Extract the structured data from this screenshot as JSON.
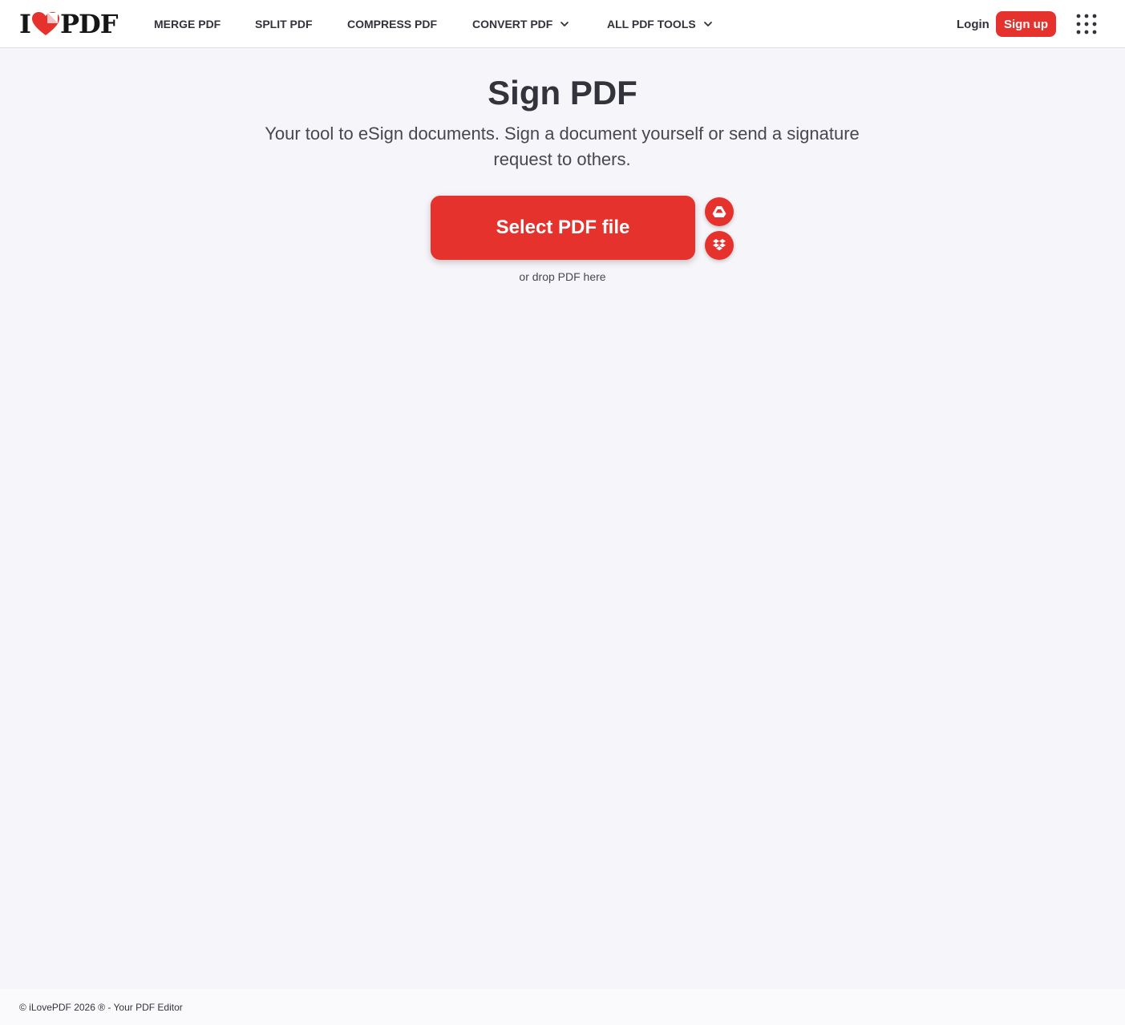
{
  "header": {
    "logo": {
      "prefix": "I",
      "suffix": "PDF"
    },
    "nav": [
      {
        "label": "MERGE PDF",
        "dropdown": false
      },
      {
        "label": "SPLIT PDF",
        "dropdown": false
      },
      {
        "label": "COMPRESS PDF",
        "dropdown": false
      },
      {
        "label": "CONVERT PDF",
        "dropdown": true
      },
      {
        "label": "ALL PDF TOOLS",
        "dropdown": true
      }
    ],
    "login_label": "Login",
    "signup_label": "Sign up",
    "apps_icon": "grid-icon"
  },
  "main": {
    "title": "Sign PDF",
    "subtitle": "Your tool to eSign documents. Sign a document yourself or send a signature request to others.",
    "select_button_label": "Select PDF file",
    "cloud_buttons": [
      {
        "icon": "google-drive-icon"
      },
      {
        "icon": "dropbox-icon"
      }
    ],
    "drop_hint": "or drop PDF here"
  },
  "footer": {
    "copyright": "© iLovePDF 2026 ® - Your PDF Editor"
  },
  "colors": {
    "brand_red": "#e5322d",
    "text_dark": "#33333b",
    "background": "#f5f5fa"
  }
}
